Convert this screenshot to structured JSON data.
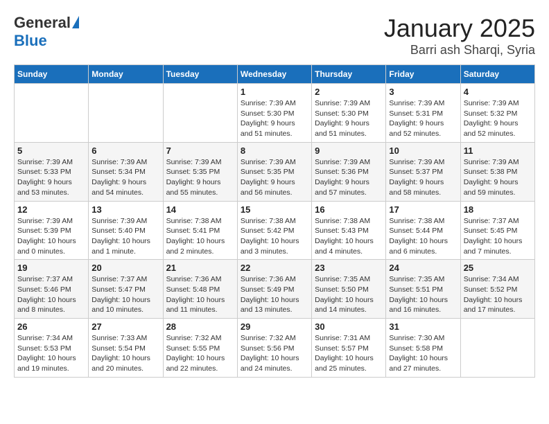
{
  "header": {
    "logo_general": "General",
    "logo_blue": "Blue",
    "month_title": "January 2025",
    "location": "Barri ash Sharqi, Syria"
  },
  "weekdays": [
    "Sunday",
    "Monday",
    "Tuesday",
    "Wednesday",
    "Thursday",
    "Friday",
    "Saturday"
  ],
  "weeks": [
    [
      {
        "day": "",
        "info": ""
      },
      {
        "day": "",
        "info": ""
      },
      {
        "day": "",
        "info": ""
      },
      {
        "day": "1",
        "info": "Sunrise: 7:39 AM\nSunset: 5:30 PM\nDaylight: 9 hours\nand 51 minutes."
      },
      {
        "day": "2",
        "info": "Sunrise: 7:39 AM\nSunset: 5:30 PM\nDaylight: 9 hours\nand 51 minutes."
      },
      {
        "day": "3",
        "info": "Sunrise: 7:39 AM\nSunset: 5:31 PM\nDaylight: 9 hours\nand 52 minutes."
      },
      {
        "day": "4",
        "info": "Sunrise: 7:39 AM\nSunset: 5:32 PM\nDaylight: 9 hours\nand 52 minutes."
      }
    ],
    [
      {
        "day": "5",
        "info": "Sunrise: 7:39 AM\nSunset: 5:33 PM\nDaylight: 9 hours\nand 53 minutes."
      },
      {
        "day": "6",
        "info": "Sunrise: 7:39 AM\nSunset: 5:34 PM\nDaylight: 9 hours\nand 54 minutes."
      },
      {
        "day": "7",
        "info": "Sunrise: 7:39 AM\nSunset: 5:35 PM\nDaylight: 9 hours\nand 55 minutes."
      },
      {
        "day": "8",
        "info": "Sunrise: 7:39 AM\nSunset: 5:35 PM\nDaylight: 9 hours\nand 56 minutes."
      },
      {
        "day": "9",
        "info": "Sunrise: 7:39 AM\nSunset: 5:36 PM\nDaylight: 9 hours\nand 57 minutes."
      },
      {
        "day": "10",
        "info": "Sunrise: 7:39 AM\nSunset: 5:37 PM\nDaylight: 9 hours\nand 58 minutes."
      },
      {
        "day": "11",
        "info": "Sunrise: 7:39 AM\nSunset: 5:38 PM\nDaylight: 9 hours\nand 59 minutes."
      }
    ],
    [
      {
        "day": "12",
        "info": "Sunrise: 7:39 AM\nSunset: 5:39 PM\nDaylight: 10 hours\nand 0 minutes."
      },
      {
        "day": "13",
        "info": "Sunrise: 7:39 AM\nSunset: 5:40 PM\nDaylight: 10 hours\nand 1 minute."
      },
      {
        "day": "14",
        "info": "Sunrise: 7:38 AM\nSunset: 5:41 PM\nDaylight: 10 hours\nand 2 minutes."
      },
      {
        "day": "15",
        "info": "Sunrise: 7:38 AM\nSunset: 5:42 PM\nDaylight: 10 hours\nand 3 minutes."
      },
      {
        "day": "16",
        "info": "Sunrise: 7:38 AM\nSunset: 5:43 PM\nDaylight: 10 hours\nand 4 minutes."
      },
      {
        "day": "17",
        "info": "Sunrise: 7:38 AM\nSunset: 5:44 PM\nDaylight: 10 hours\nand 6 minutes."
      },
      {
        "day": "18",
        "info": "Sunrise: 7:37 AM\nSunset: 5:45 PM\nDaylight: 10 hours\nand 7 minutes."
      }
    ],
    [
      {
        "day": "19",
        "info": "Sunrise: 7:37 AM\nSunset: 5:46 PM\nDaylight: 10 hours\nand 8 minutes."
      },
      {
        "day": "20",
        "info": "Sunrise: 7:37 AM\nSunset: 5:47 PM\nDaylight: 10 hours\nand 10 minutes."
      },
      {
        "day": "21",
        "info": "Sunrise: 7:36 AM\nSunset: 5:48 PM\nDaylight: 10 hours\nand 11 minutes."
      },
      {
        "day": "22",
        "info": "Sunrise: 7:36 AM\nSunset: 5:49 PM\nDaylight: 10 hours\nand 13 minutes."
      },
      {
        "day": "23",
        "info": "Sunrise: 7:35 AM\nSunset: 5:50 PM\nDaylight: 10 hours\nand 14 minutes."
      },
      {
        "day": "24",
        "info": "Sunrise: 7:35 AM\nSunset: 5:51 PM\nDaylight: 10 hours\nand 16 minutes."
      },
      {
        "day": "25",
        "info": "Sunrise: 7:34 AM\nSunset: 5:52 PM\nDaylight: 10 hours\nand 17 minutes."
      }
    ],
    [
      {
        "day": "26",
        "info": "Sunrise: 7:34 AM\nSunset: 5:53 PM\nDaylight: 10 hours\nand 19 minutes."
      },
      {
        "day": "27",
        "info": "Sunrise: 7:33 AM\nSunset: 5:54 PM\nDaylight: 10 hours\nand 20 minutes."
      },
      {
        "day": "28",
        "info": "Sunrise: 7:32 AM\nSunset: 5:55 PM\nDaylight: 10 hours\nand 22 minutes."
      },
      {
        "day": "29",
        "info": "Sunrise: 7:32 AM\nSunset: 5:56 PM\nDaylight: 10 hours\nand 24 minutes."
      },
      {
        "day": "30",
        "info": "Sunrise: 7:31 AM\nSunset: 5:57 PM\nDaylight: 10 hours\nand 25 minutes."
      },
      {
        "day": "31",
        "info": "Sunrise: 7:30 AM\nSunset: 5:58 PM\nDaylight: 10 hours\nand 27 minutes."
      },
      {
        "day": "",
        "info": ""
      }
    ]
  ]
}
